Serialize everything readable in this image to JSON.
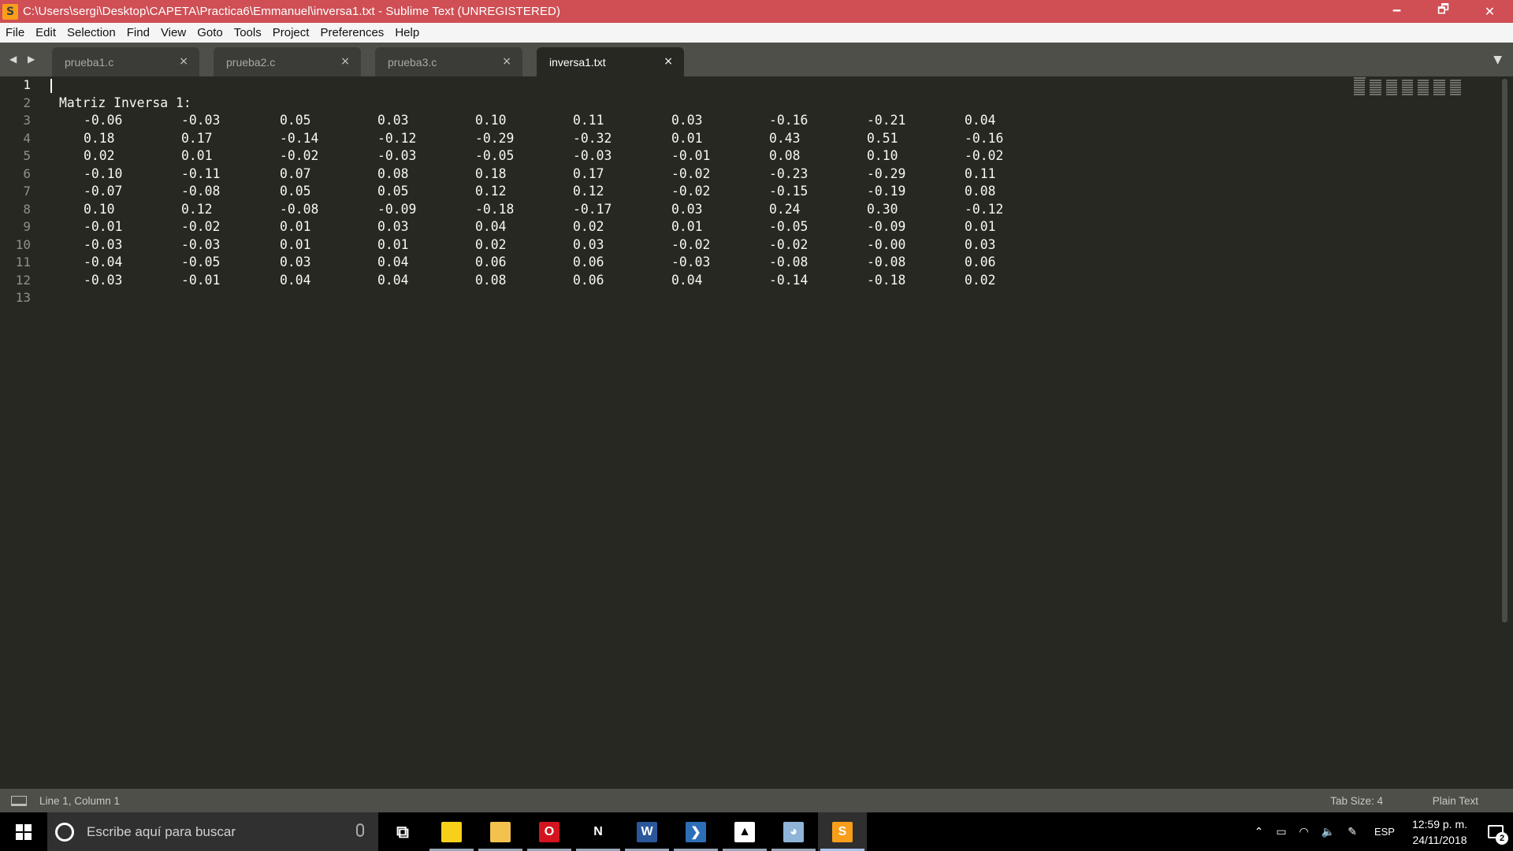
{
  "window": {
    "title": "C:\\Users\\sergi\\Desktop\\CAPETA\\Practica6\\Emmanuel\\inversa1.txt - Sublime Text (UNREGISTERED)",
    "app_icon": "S",
    "controls": {
      "minimize": "🗕",
      "restore": "🗗",
      "close": "✕"
    }
  },
  "menu": [
    "File",
    "Edit",
    "Selection",
    "Find",
    "View",
    "Goto",
    "Tools",
    "Project",
    "Preferences",
    "Help"
  ],
  "tabs": [
    {
      "label": "prueba1.c",
      "active": false
    },
    {
      "label": "prueba2.c",
      "active": false
    },
    {
      "label": "prueba3.c",
      "active": false
    },
    {
      "label": "inversa1.txt",
      "active": true
    }
  ],
  "tab_nav": "◀ ▶",
  "tab_dropdown": "▼",
  "tab_close": "×",
  "editor": {
    "line_numbers": [
      "1",
      "2",
      "3",
      "4",
      "5",
      "6",
      "7",
      "8",
      "9",
      "10",
      "11",
      "12",
      "13"
    ],
    "heading": "Matriz Inversa 1:",
    "matrix": [
      [
        "-0.06",
        "-0.03",
        "0.05",
        "0.03",
        "0.10",
        "0.11",
        "0.03",
        "-0.16",
        "-0.21",
        "0.04"
      ],
      [
        "0.18",
        "0.17",
        "-0.14",
        "-0.12",
        "-0.29",
        "-0.32",
        "0.01",
        "0.43",
        "0.51",
        "-0.16"
      ],
      [
        "0.02",
        "0.01",
        "-0.02",
        "-0.03",
        "-0.05",
        "-0.03",
        "-0.01",
        "0.08",
        "0.10",
        "-0.02"
      ],
      [
        "-0.10",
        "-0.11",
        "0.07",
        "0.08",
        "0.18",
        "0.17",
        "-0.02",
        "-0.23",
        "-0.29",
        "0.11"
      ],
      [
        "-0.07",
        "-0.08",
        "0.05",
        "0.05",
        "0.12",
        "0.12",
        "-0.02",
        "-0.15",
        "-0.19",
        "0.08"
      ],
      [
        "0.10",
        "0.12",
        "-0.08",
        "-0.09",
        "-0.18",
        "-0.17",
        "0.03",
        "0.24",
        "0.30",
        "-0.12"
      ],
      [
        "-0.01",
        "-0.02",
        "0.01",
        "0.03",
        "0.04",
        "0.02",
        "0.01",
        "-0.05",
        "-0.09",
        "0.01"
      ],
      [
        "-0.03",
        "-0.03",
        "0.01",
        "0.01",
        "0.02",
        "0.03",
        "-0.02",
        "-0.02",
        "-0.00",
        "0.03"
      ],
      [
        "-0.04",
        "-0.05",
        "0.03",
        "0.04",
        "0.06",
        "0.06",
        "-0.03",
        "-0.08",
        "-0.08",
        "0.06"
      ],
      [
        "-0.03",
        "-0.01",
        "0.04",
        "0.04",
        "0.08",
        "0.06",
        "0.04",
        "-0.14",
        "-0.18",
        "0.02"
      ]
    ]
  },
  "status": {
    "position": "Line 1, Column 1",
    "tab_size": "Tab Size: 4",
    "syntax": "Plain Text"
  },
  "taskbar": {
    "search_placeholder": "Escribe aquí para buscar",
    "apps": [
      {
        "name": "task-view-icon",
        "glyph": "⧉",
        "color": "#000000"
      },
      {
        "name": "sticky-notes-icon",
        "glyph": "",
        "color": "#f7d01a"
      },
      {
        "name": "file-explorer-icon",
        "glyph": "",
        "color": "#f2c14e"
      },
      {
        "name": "opera-icon",
        "glyph": "O",
        "color": "#d3141f"
      },
      {
        "name": "netflix-icon",
        "glyph": "N",
        "color": "#000000"
      },
      {
        "name": "word-icon",
        "glyph": "W",
        "color": "#2b579a"
      },
      {
        "name": "powershell-icon",
        "glyph": "❯",
        "color": "#2d6fb7"
      },
      {
        "name": "photos-icon",
        "glyph": "▲",
        "color": "#ffffff"
      },
      {
        "name": "paint-icon",
        "glyph": "◕",
        "color": "#8fb4d8"
      },
      {
        "name": "sublime-text-icon",
        "glyph": "S",
        "color": "#f99e1b"
      }
    ],
    "tray": {
      "language": "ESP",
      "time": "12:59 p. m.",
      "date": "24/11/2018",
      "notifications": "2"
    }
  },
  "colors": {
    "titlebar": "#cf4f55",
    "editor_bg": "#272822",
    "tabbar": "#4e4f49",
    "text": "#f8f8f2"
  }
}
